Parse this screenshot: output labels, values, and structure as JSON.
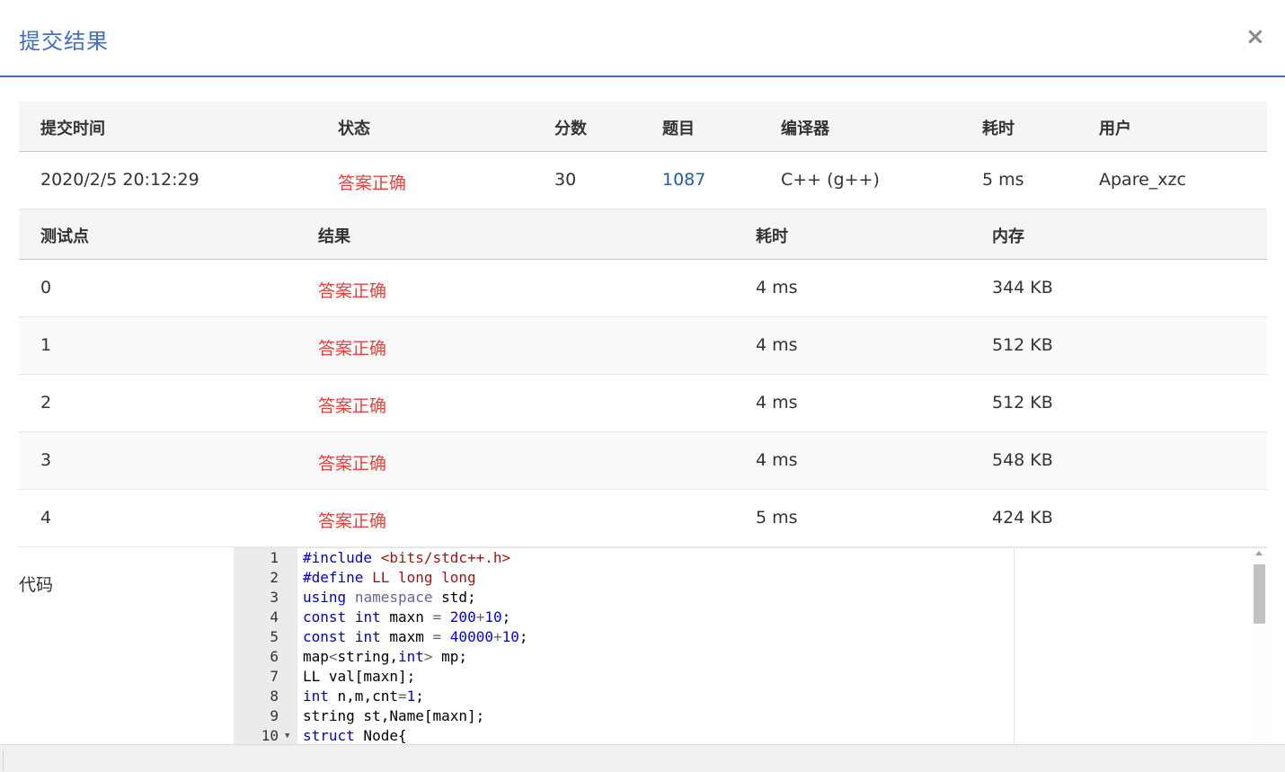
{
  "dialog": {
    "title": "提交结果",
    "close_symbol": "×"
  },
  "summary": {
    "headers": [
      "提交时间",
      "状态",
      "分数",
      "题目",
      "编译器",
      "耗时",
      "用户"
    ],
    "row": {
      "time": "2020/2/5 20:12:29",
      "status": "答案正确",
      "score": "30",
      "problem": "1087",
      "compiler": "C++ (g++)",
      "duration": "5 ms",
      "user": "Apare_xzc"
    }
  },
  "tests": {
    "headers": [
      "测试点",
      "结果",
      "耗时",
      "内存"
    ],
    "rows": [
      {
        "id": "0",
        "result": "答案正确",
        "time": "4 ms",
        "memory": "344 KB"
      },
      {
        "id": "1",
        "result": "答案正确",
        "time": "4 ms",
        "memory": "512 KB"
      },
      {
        "id": "2",
        "result": "答案正确",
        "time": "4 ms",
        "memory": "512 KB"
      },
      {
        "id": "3",
        "result": "答案正确",
        "time": "4 ms",
        "memory": "548 KB"
      },
      {
        "id": "4",
        "result": "答案正确",
        "time": "5 ms",
        "memory": "424 KB"
      }
    ]
  },
  "code": {
    "label": "代码",
    "line_numbers": [
      "1",
      "2",
      "3",
      "4",
      "5",
      "6",
      "7",
      "8",
      "9",
      "10"
    ],
    "lines": [
      "#include <bits/stdc++.h>",
      "#define LL long long",
      "using namespace std;",
      "const int maxn = 200+10;",
      "const int maxm = 40000+10;",
      "map<string,int> mp;",
      "LL val[maxn];",
      "int n,m,cnt=1;",
      "string st,Name[maxn];",
      "struct Node{"
    ]
  },
  "colors": {
    "accent": "#3f6ec4",
    "ok": "#e8413a",
    "link": "#1f5fa8"
  }
}
